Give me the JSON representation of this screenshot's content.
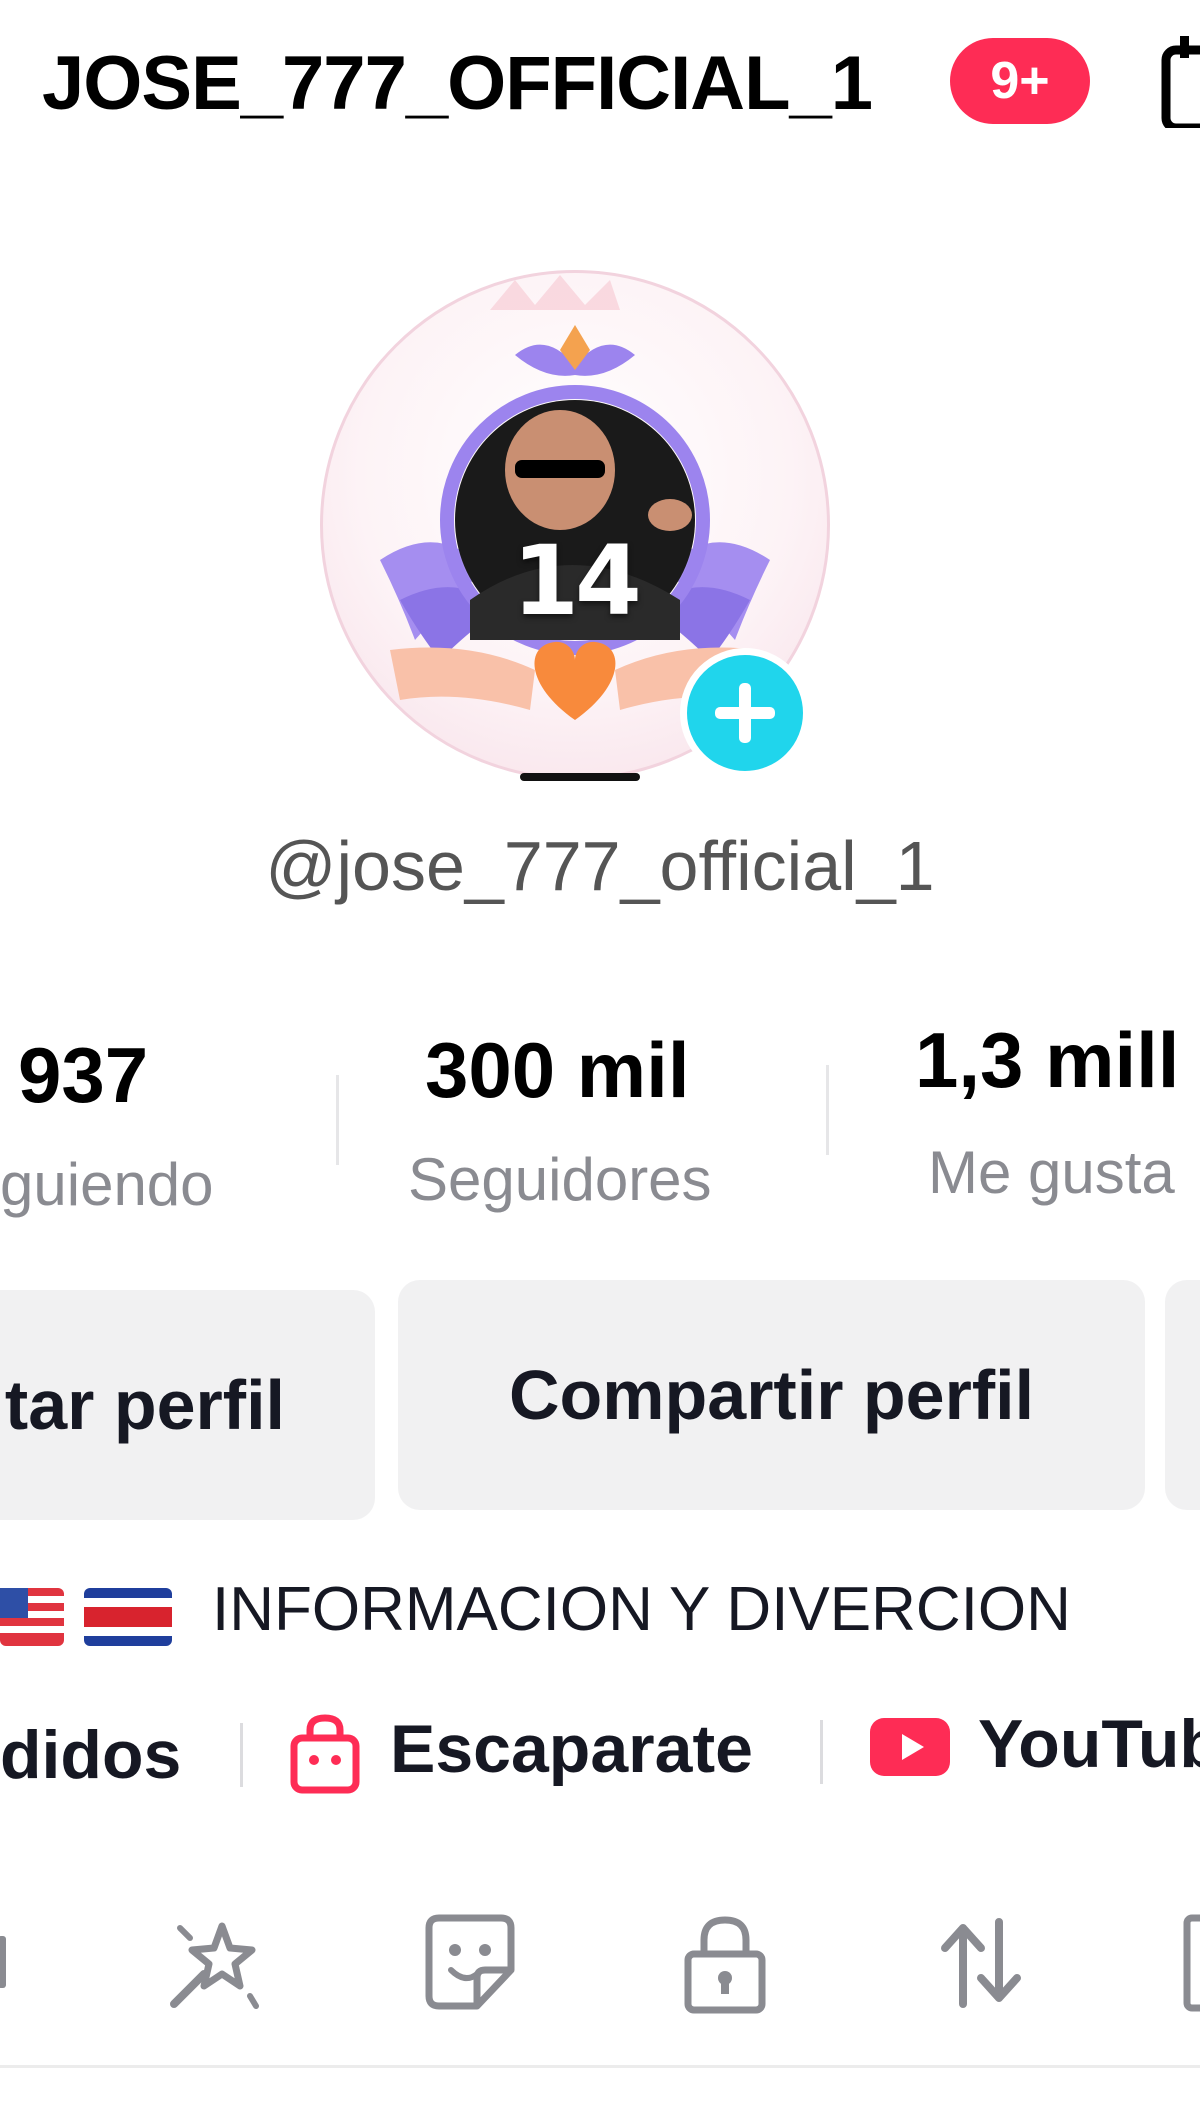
{
  "header": {
    "title": "JOSE_777_OFFICIAL_1",
    "notification_badge": "9+"
  },
  "avatar": {
    "level": "14",
    "add_icon": "plus-icon"
  },
  "profile": {
    "username": "@jose_777_official_1"
  },
  "stats": [
    {
      "value": "937",
      "label": "guiendo"
    },
    {
      "value": "300 mil",
      "label": "Seguidores"
    },
    {
      "value": "1,3 mill",
      "label": "Me gusta"
    }
  ],
  "buttons": {
    "edit_profile": "tar perfil",
    "share_profile": "Compartir perfil"
  },
  "bio": {
    "flags": [
      "us-flag-icon",
      "costa-rica-flag-icon"
    ],
    "text": "INFORMACION  Y DIVERCION"
  },
  "links": [
    {
      "label": "didos",
      "icon": ""
    },
    {
      "label": "Escaparate",
      "icon": "shopping-bag-icon"
    },
    {
      "label": "YouTub",
      "icon": "youtube-icon"
    }
  ],
  "tabs": [
    "magic-wand-icon",
    "sticker-icon",
    "lock-icon",
    "repost-icon"
  ],
  "colors": {
    "badge": "#fe2c55",
    "add_button": "#20d5ec",
    "link_icon": "#fe2c55",
    "secondary_text": "#8a8b91"
  }
}
